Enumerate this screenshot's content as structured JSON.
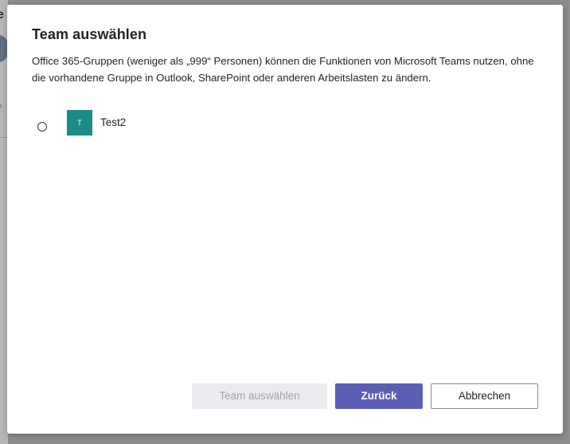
{
  "background_app": {
    "partial_text": "e",
    "partial_small_1": "i",
    "partial_small_2": "e"
  },
  "dialog": {
    "title": "Team auswählen",
    "description": "Office 365-Gruppen (weniger als „999“ Personen) können die Funktionen von Microsoft Teams nutzen, ohne die vorhandene Gruppe in Outlook, SharePoint oder anderen Arbeitslasten zu ändern.",
    "teams": [
      {
        "initial": "T",
        "name": "Test2",
        "selected": false,
        "avatar_color": "#1c8a87"
      }
    ],
    "buttons": {
      "select_label": "Team auswählen",
      "select_enabled": false,
      "back_label": "Zurück",
      "cancel_label": "Abbrechen"
    }
  },
  "colors": {
    "primary": "#5b5fb4",
    "disabled_bg": "#ebecf0",
    "disabled_text": "#a3a3a8",
    "overlay": "#8c8c8f"
  }
}
